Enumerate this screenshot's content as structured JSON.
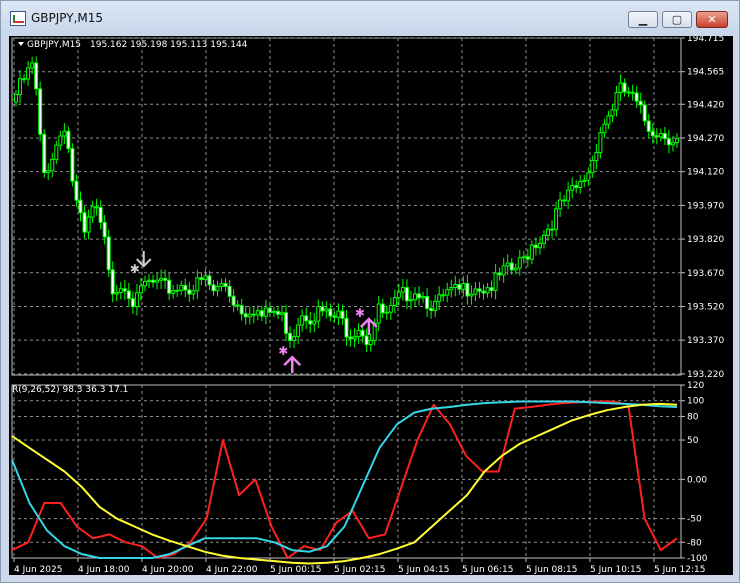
{
  "window": {
    "title": "GBPJPY,M15",
    "minimize_label": "▁",
    "maximize_label": "▢",
    "close_label": "✕"
  },
  "colors": {
    "background": "#000000",
    "grid": "#8f8f8f",
    "candle": "#00ff00",
    "candle_bull_fill": "#000000",
    "candle_bear_fill": "#ffffff",
    "up_arrow": "#ee82ee",
    "down_arrow": "#d0d0d0",
    "red_line": "#ff2020",
    "cyan_line": "#34d6e6",
    "yellow_line": "#ffff33"
  },
  "chart_data": [
    {
      "type": "candlestick",
      "title": "GBPJPY,M15  195.162 195.198 195.113 195.144",
      "legend_label": "GBPJPY,M15",
      "ohlc_text": "195.162 195.198 195.113 195.144",
      "y_ticks": [
        "194.715",
        "194.565",
        "194.420",
        "194.270",
        "194.120",
        "193.970",
        "193.820",
        "193.670",
        "193.520",
        "193.370",
        "193.220"
      ],
      "ylim": [
        193.215,
        194.715
      ],
      "grid": true,
      "close_path": [
        [
          0,
          194.43
        ],
        [
          5,
          194.53
        ],
        [
          9,
          194.6
        ],
        [
          13,
          194.1
        ],
        [
          17,
          194.2
        ],
        [
          22,
          194.34
        ],
        [
          26,
          194.01
        ],
        [
          30,
          193.83
        ],
        [
          34,
          193.97
        ],
        [
          38,
          193.83
        ],
        [
          42,
          193.6
        ],
        [
          47,
          193.63
        ],
        [
          51,
          193.52
        ],
        [
          55,
          193.62
        ],
        [
          59,
          193.62
        ],
        [
          63,
          193.6
        ],
        [
          67,
          193.6
        ],
        [
          71,
          193.62
        ],
        [
          75,
          193.6
        ],
        [
          80,
          193.64
        ],
        [
          84,
          193.58
        ],
        [
          88,
          193.63
        ],
        [
          92,
          193.55
        ],
        [
          96,
          193.5
        ],
        [
          100,
          193.52
        ],
        [
          104,
          193.47
        ],
        [
          108,
          193.5
        ],
        [
          112,
          193.47
        ],
        [
          116,
          193.38
        ],
        [
          120,
          193.5
        ],
        [
          124,
          193.48
        ],
        [
          128,
          193.5
        ],
        [
          132,
          193.47
        ],
        [
          136,
          193.47
        ],
        [
          140,
          193.4
        ],
        [
          144,
          193.44
        ],
        [
          148,
          193.36
        ],
        [
          152,
          193.5
        ],
        [
          156,
          193.47
        ],
        [
          160,
          193.55
        ],
        [
          164,
          193.58
        ],
        [
          168,
          193.6
        ],
        [
          172,
          193.55
        ],
        [
          176,
          193.52
        ],
        [
          180,
          193.57
        ],
        [
          184,
          193.58
        ],
        [
          188,
          193.6
        ],
        [
          192,
          193.62
        ],
        [
          196,
          193.6
        ],
        [
          200,
          193.62
        ],
        [
          204,
          193.67
        ],
        [
          208,
          193.68
        ],
        [
          212,
          193.72
        ],
        [
          216,
          193.8
        ],
        [
          220,
          193.83
        ],
        [
          224,
          193.9
        ],
        [
          228,
          193.97
        ],
        [
          232,
          194.02
        ],
        [
          236,
          194.06
        ],
        [
          240,
          194.14
        ],
        [
          244,
          194.3
        ],
        [
          248,
          194.38
        ],
        [
          252,
          194.48
        ],
        [
          256,
          194.47
        ],
        [
          260,
          194.4
        ],
        [
          264,
          194.32
        ],
        [
          268,
          194.3
        ],
        [
          272,
          194.28
        ],
        [
          276,
          194.26
        ]
      ],
      "signals": [
        {
          "type": "sell-arrow",
          "x": 50,
          "y": 193.66
        },
        {
          "type": "buy-arrow",
          "x": 112,
          "y": 193.33
        },
        {
          "type": "buy-arrow",
          "x": 144,
          "y": 193.5
        }
      ]
    },
    {
      "type": "line",
      "title": "R(9,26,52) 98.3 36.3 17.1",
      "legend_label": "R(9,26,52) 98.3 36.3 17.1",
      "y_ticks": [
        "120",
        "100",
        "80",
        "50",
        "0.00",
        "-50",
        "-80",
        "-100"
      ],
      "ylim": [
        -100,
        120
      ],
      "grid": true,
      "series": [
        {
          "name": "red",
          "values": [
            -90,
            -80,
            -30,
            -30,
            -60,
            -75,
            -70,
            -80,
            -85,
            -100,
            -95,
            -80,
            -50,
            50,
            -20,
            0,
            -60,
            -100,
            -85,
            -90,
            -55,
            -40,
            -75,
            -70,
            -10,
            50,
            95,
            70,
            30,
            10,
            10,
            90,
            92,
            95,
            97,
            98,
            99,
            99,
            95,
            -50,
            -90,
            -75
          ]
        },
        {
          "name": "cyan",
          "values": [
            25,
            -30,
            -65,
            -85,
            -95,
            -100,
            -100,
            -100,
            -100,
            -95,
            -85,
            -75,
            -75,
            -75,
            -75,
            -80,
            -90,
            -92,
            -85,
            -60,
            -10,
            40,
            70,
            85,
            90,
            92,
            95,
            97,
            98,
            99,
            99,
            99,
            99,
            98,
            97,
            96,
            95,
            93,
            92
          ]
        },
        {
          "name": "yellow",
          "values": [
            55,
            40,
            25,
            10,
            -10,
            -35,
            -50,
            -60,
            -70,
            -78,
            -85,
            -92,
            -97,
            -100,
            -102,
            -104,
            -106,
            -107,
            -106,
            -104,
            -100,
            -95,
            -88,
            -80,
            -60,
            -40,
            -20,
            10,
            30,
            45,
            55,
            65,
            75,
            82,
            88,
            92,
            95,
            96,
            95
          ]
        }
      ]
    }
  ],
  "x_axis_labels": [
    "4 Jun 2025",
    "4 Jun 18:00",
    "4 Jun 20:00",
    "4 Jun 22:00",
    "5 Jun 00:15",
    "5 Jun 02:15",
    "5 Jun 04:15",
    "5 Jun 06:15",
    "5 Jun 08:15",
    "5 Jun 10:15",
    "5 Jun 12:15"
  ]
}
